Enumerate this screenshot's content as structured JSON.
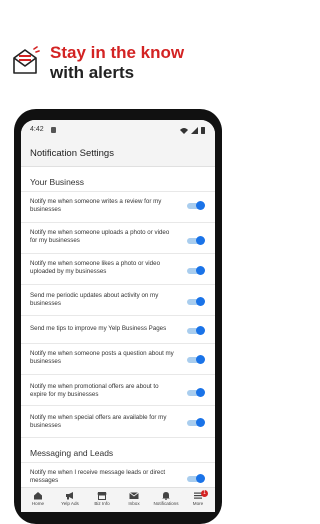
{
  "promo": {
    "headline_line1": "Stay in the know",
    "headline_line2": "with alerts"
  },
  "status_bar": {
    "time": "4:42"
  },
  "app_bar": {
    "title": "Notification Settings"
  },
  "sections": [
    {
      "title": "Your Business",
      "items": [
        {
          "text": "Notify me when someone writes a review for my businesses",
          "enabled": true
        },
        {
          "text": "Notify me when someone uploads a photo or video for my businesses",
          "enabled": true
        },
        {
          "text": "Notify me when someone likes a photo or video uploaded by my businesses",
          "enabled": true
        },
        {
          "text": "Send me periodic updates about activity on my businesses",
          "enabled": true
        },
        {
          "text": "Send me tips to improve my Yelp Business Pages",
          "enabled": true
        },
        {
          "text": "Notify me when someone posts a question about my businesses",
          "enabled": true
        },
        {
          "text": "Notify me when promotional offers are about to expire for my businesses",
          "enabled": true
        },
        {
          "text": "Notify me when special offers are available for my businesses",
          "enabled": true
        }
      ]
    },
    {
      "title": "Messaging and Leads",
      "items": [
        {
          "text": "Notify me when I receive message leads or direct messages",
          "enabled": true
        }
      ]
    }
  ],
  "tabs": [
    {
      "label": "Home",
      "icon": "home-icon"
    },
    {
      "label": "Yelp Ads",
      "icon": "megaphone-icon"
    },
    {
      "label": "Biz Info",
      "icon": "storefront-icon"
    },
    {
      "label": "Inbox",
      "icon": "envelope-icon"
    },
    {
      "label": "Notifications",
      "icon": "bell-icon"
    },
    {
      "label": "More",
      "icon": "menu-icon",
      "badge": "1"
    }
  ],
  "colors": {
    "brand_red": "#d32323",
    "toggle_on": "#1a73e8",
    "toggle_track": "#a9cdee"
  }
}
